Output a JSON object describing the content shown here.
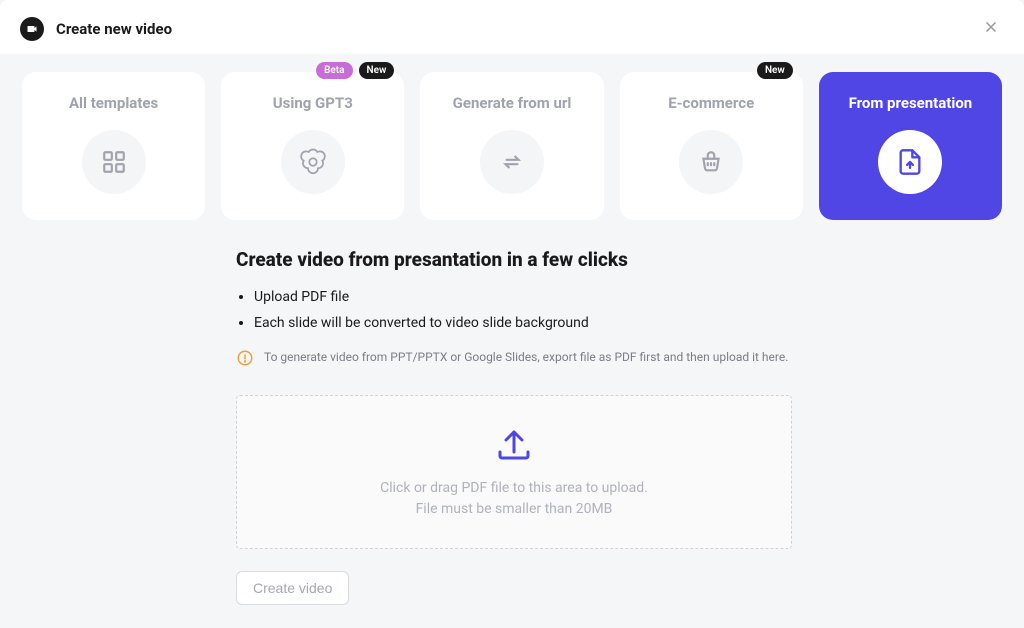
{
  "header": {
    "title": "Create new video"
  },
  "tabs": [
    {
      "label": "All templates",
      "badges": []
    },
    {
      "label": "Using GPT3",
      "badges": [
        "Beta",
        "New"
      ]
    },
    {
      "label": "Generate from url",
      "badges": []
    },
    {
      "label": "E-commerce",
      "badges": [
        "New"
      ]
    },
    {
      "label": "From presentation",
      "badges": [],
      "active": true
    }
  ],
  "section": {
    "title": "Create video from presantation in a few clicks",
    "bullets": [
      "Upload PDF file",
      "Each slide will be converted to video slide background"
    ],
    "info": "To generate video from PPT/PPTX or Google Slides, export file as PDF first and then upload it here."
  },
  "dropzone": {
    "line1": "Click or drag PDF file to this area to upload.",
    "line2": "File must be smaller than 20MB"
  },
  "actions": {
    "create": "Create video"
  },
  "badgeLabels": {
    "beta": "Beta",
    "new": "New"
  }
}
